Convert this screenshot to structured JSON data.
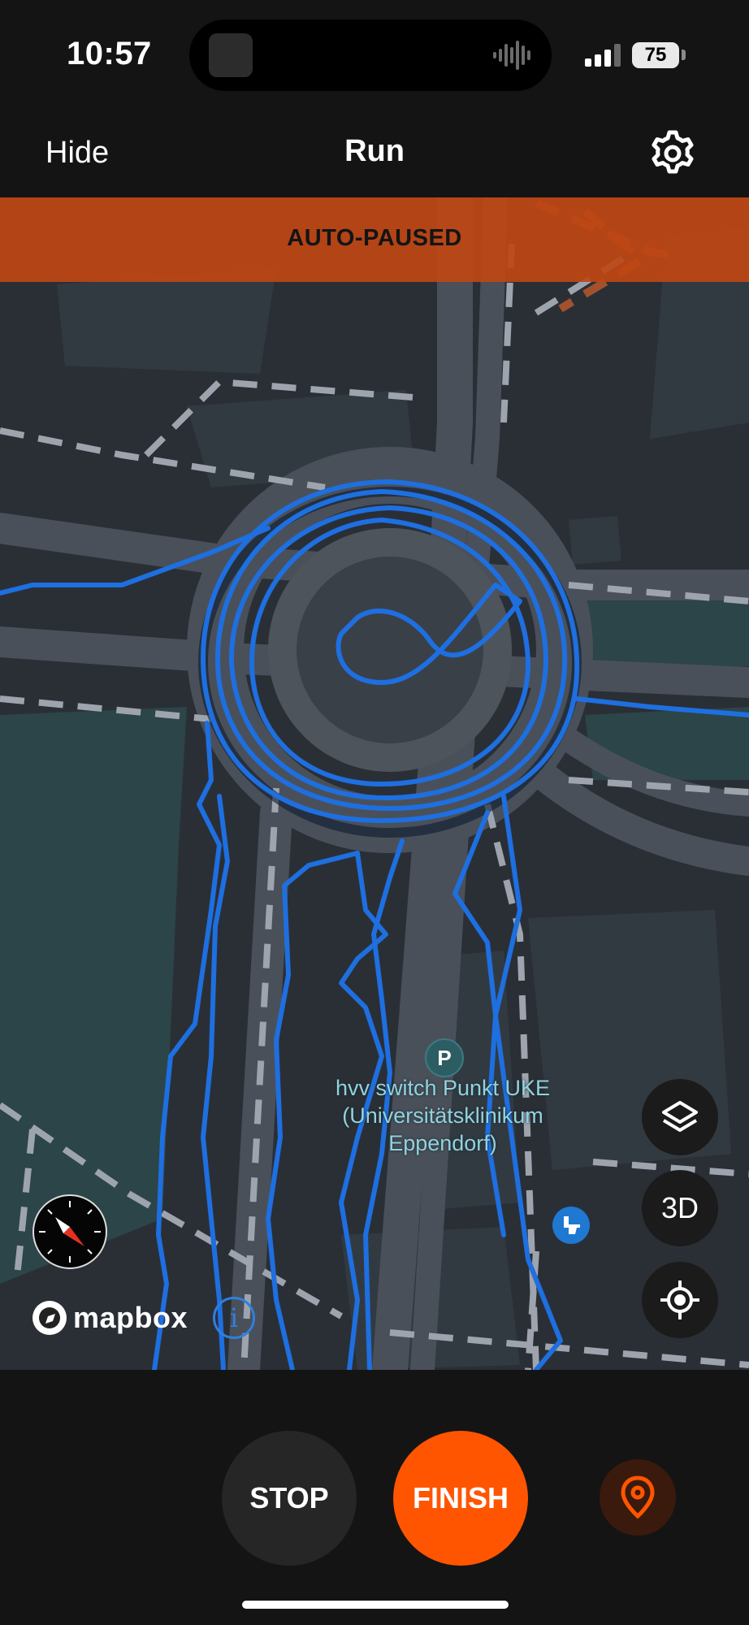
{
  "status_bar": {
    "time": "10:57",
    "battery": "75"
  },
  "nav": {
    "hide_label": "Hide",
    "title": "Run",
    "settings_icon": "gear-icon"
  },
  "banner": {
    "text": "AUTO-PAUSED",
    "color": "#BE4614"
  },
  "map": {
    "poi": {
      "icon_letter": "P",
      "label_lines": [
        "hvv switch Punkt UKE",
        "(Universitätsklinikum",
        "Eppendorf)"
      ]
    },
    "controls": {
      "layers_icon": "layers-icon",
      "three_d_label": "3D",
      "locate_icon": "crosshair-icon"
    },
    "attribution": {
      "logo_text": "mapbox",
      "info_label": "i"
    },
    "route_color": "#1E6FE0"
  },
  "actions": {
    "stop_label": "STOP",
    "finish_label": "FINISH",
    "finish_color": "#FF5500",
    "pin_icon": "location-pin-icon"
  }
}
